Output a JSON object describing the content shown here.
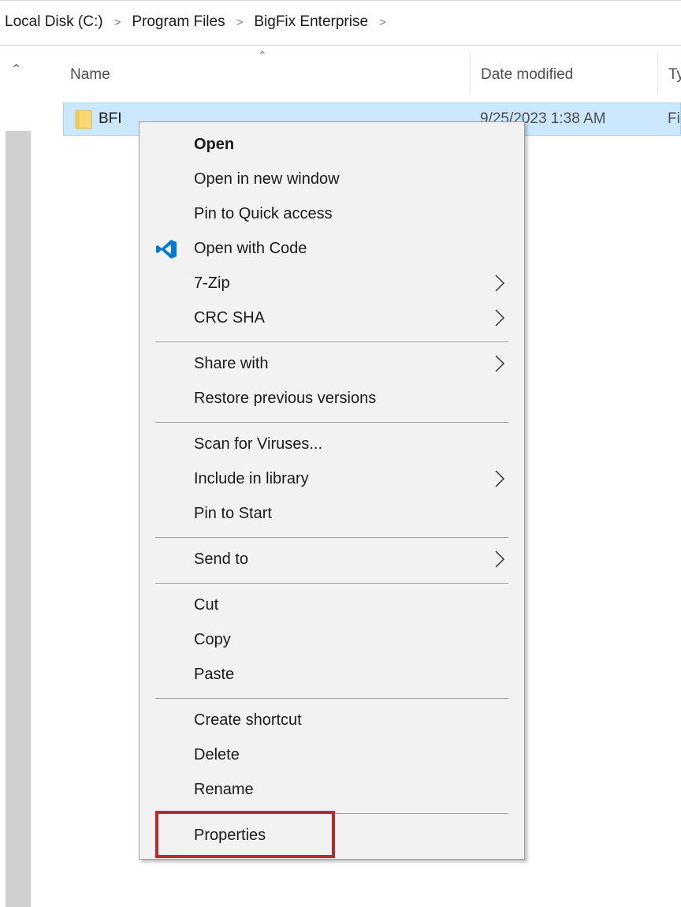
{
  "breadcrumb": {
    "items": [
      "Local Disk (C:)",
      "Program Files",
      "BigFix Enterprise"
    ],
    "separator": ">"
  },
  "columns": {
    "name": "Name",
    "date_modified": "Date modified",
    "type": "Ty"
  },
  "files": [
    {
      "name": "BFI",
      "date_modified": "9/25/2023 1:38 AM",
      "type": "Fi"
    }
  ],
  "context_menu": {
    "groups": [
      [
        {
          "label": "Open",
          "bold": true
        },
        {
          "label": "Open in new window"
        },
        {
          "label": "Pin to Quick access"
        },
        {
          "label": "Open with Code",
          "icon": "vscode-icon"
        },
        {
          "label": "7-Zip",
          "submenu": true
        },
        {
          "label": "CRC SHA",
          "submenu": true
        }
      ],
      [
        {
          "label": "Share with",
          "submenu": true
        },
        {
          "label": "Restore previous versions"
        }
      ],
      [
        {
          "label": "Scan for Viruses..."
        },
        {
          "label": "Include in library",
          "submenu": true
        },
        {
          "label": "Pin to Start"
        }
      ],
      [
        {
          "label": "Send to",
          "submenu": true
        }
      ],
      [
        {
          "label": "Cut"
        },
        {
          "label": "Copy"
        },
        {
          "label": "Paste"
        }
      ],
      [
        {
          "label": "Create shortcut"
        },
        {
          "label": "Delete"
        },
        {
          "label": "Rename"
        }
      ],
      [
        {
          "label": "Properties",
          "highlighted": true
        }
      ]
    ]
  },
  "colors": {
    "selection_fill": "#cce8ff",
    "selection_border": "#99d1ff",
    "menu_background": "#f2f2f2",
    "highlight_box": "#c1272d",
    "vscode_blue": "#0078d4"
  }
}
